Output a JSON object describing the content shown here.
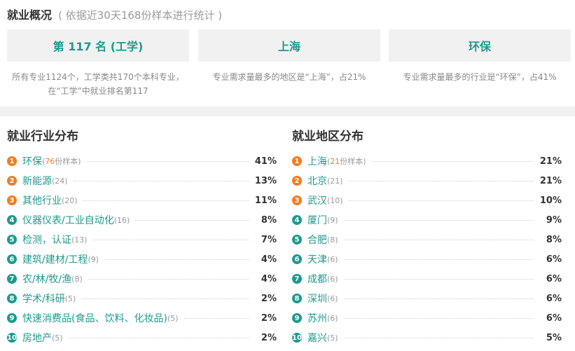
{
  "header": {
    "title": "就业概况",
    "subtitle": "( 依据近30天168份样本进行统计 )"
  },
  "cards": [
    {
      "value": "第 117 名 (工学)",
      "desc": "所有专业1124个，工学类共170个本科专业，在“工学”中就业排名第117"
    },
    {
      "value": "上海",
      "desc": "专业需求量最多的地区是“上海”，占21%"
    },
    {
      "value": "环保",
      "desc": "专业需求量最多的行业是“环保”，占41%"
    }
  ],
  "industry": {
    "title": "就业行业分布",
    "items": [
      {
        "rank": "1",
        "name": "环保",
        "count": "76",
        "count_suffix": "份样本",
        "pct": "41%"
      },
      {
        "rank": "2",
        "name": "新能源",
        "count": "(24)",
        "pct": "13%"
      },
      {
        "rank": "3",
        "name": "其他行业",
        "count": "(20)",
        "pct": "11%"
      },
      {
        "rank": "4",
        "name": "仪器仪表/工业自动化",
        "count": "(16)",
        "pct": "8%"
      },
      {
        "rank": "5",
        "name": "检测，认证",
        "count": "(13)",
        "pct": "7%"
      },
      {
        "rank": "6",
        "name": "建筑/建材/工程",
        "count": "(9)",
        "pct": "4%"
      },
      {
        "rank": "7",
        "name": "农/林/牧/渔",
        "count": "(8)",
        "pct": "4%"
      },
      {
        "rank": "8",
        "name": "学术/科研",
        "count": "(5)",
        "pct": "2%"
      },
      {
        "rank": "9",
        "name": "快速消费品(食品、饮料、化妆品)",
        "count": "(5)",
        "pct": "2%"
      },
      {
        "rank": "10",
        "name": "房地产",
        "count": "(5)",
        "pct": "2%"
      }
    ]
  },
  "region": {
    "title": "就业地区分布",
    "items": [
      {
        "rank": "1",
        "name": "上海",
        "count": "21",
        "count_suffix": "份样本",
        "pct": "21%"
      },
      {
        "rank": "2",
        "name": "北京",
        "count": "(21)",
        "pct": "21%"
      },
      {
        "rank": "3",
        "name": "武汉",
        "count": "(10)",
        "pct": "10%"
      },
      {
        "rank": "4",
        "name": "厦门",
        "count": "(9)",
        "pct": "9%"
      },
      {
        "rank": "5",
        "name": "合肥",
        "count": "(8)",
        "pct": "8%"
      },
      {
        "rank": "6",
        "name": "天津",
        "count": "(6)",
        "pct": "6%"
      },
      {
        "rank": "7",
        "name": "成都",
        "count": "(6)",
        "pct": "6%"
      },
      {
        "rank": "8",
        "name": "深圳",
        "count": "(6)",
        "pct": "6%"
      },
      {
        "rank": "9",
        "name": "苏州",
        "count": "(6)",
        "pct": "6%"
      },
      {
        "rank": "10",
        "name": "嘉兴",
        "count": "(5)",
        "pct": "5%"
      }
    ]
  },
  "colors": {
    "accent": "#1d9a8d",
    "hot": "#f47b20",
    "card_bg": "#f1f1f1"
  }
}
